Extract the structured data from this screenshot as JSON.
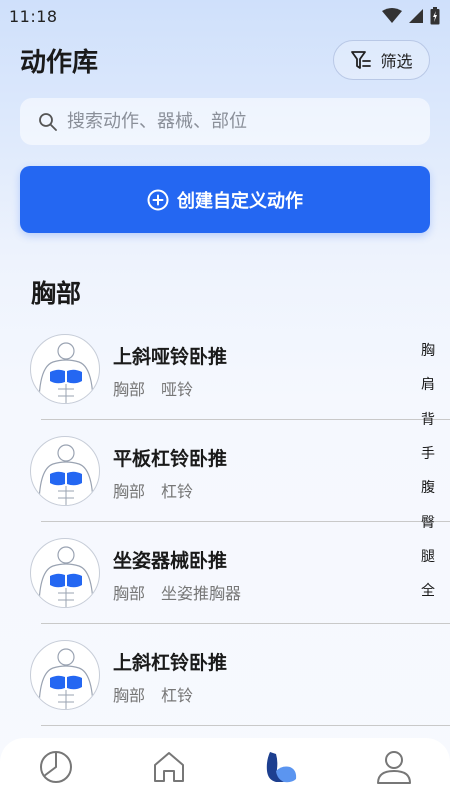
{
  "status_bar": {
    "time": "11:18"
  },
  "header": {
    "title": "动作库",
    "filter_label": "筛选"
  },
  "search": {
    "placeholder": "搜索动作、器械、部位"
  },
  "create_button": {
    "label": "创建自定义动作"
  },
  "section": {
    "title": "胸部"
  },
  "exercises": [
    {
      "name": "上斜哑铃卧推",
      "body_part": "胸部",
      "equipment": "哑铃"
    },
    {
      "name": "平板杠铃卧推",
      "body_part": "胸部",
      "equipment": "杠铃"
    },
    {
      "name": "坐姿器械卧推",
      "body_part": "胸部",
      "equipment": "坐姿推胸器"
    },
    {
      "name": "上斜杠铃卧推",
      "body_part": "胸部",
      "equipment": "杠铃"
    }
  ],
  "alpha_index": [
    "胸",
    "肩",
    "背",
    "手",
    "腹",
    "臀",
    "腿",
    "全"
  ],
  "bottom_nav": [
    "stats-icon",
    "home-icon",
    "muscle-icon",
    "profile-icon"
  ],
  "colors": {
    "accent": "#2467f2",
    "active_nav": "#1d3f8f"
  }
}
